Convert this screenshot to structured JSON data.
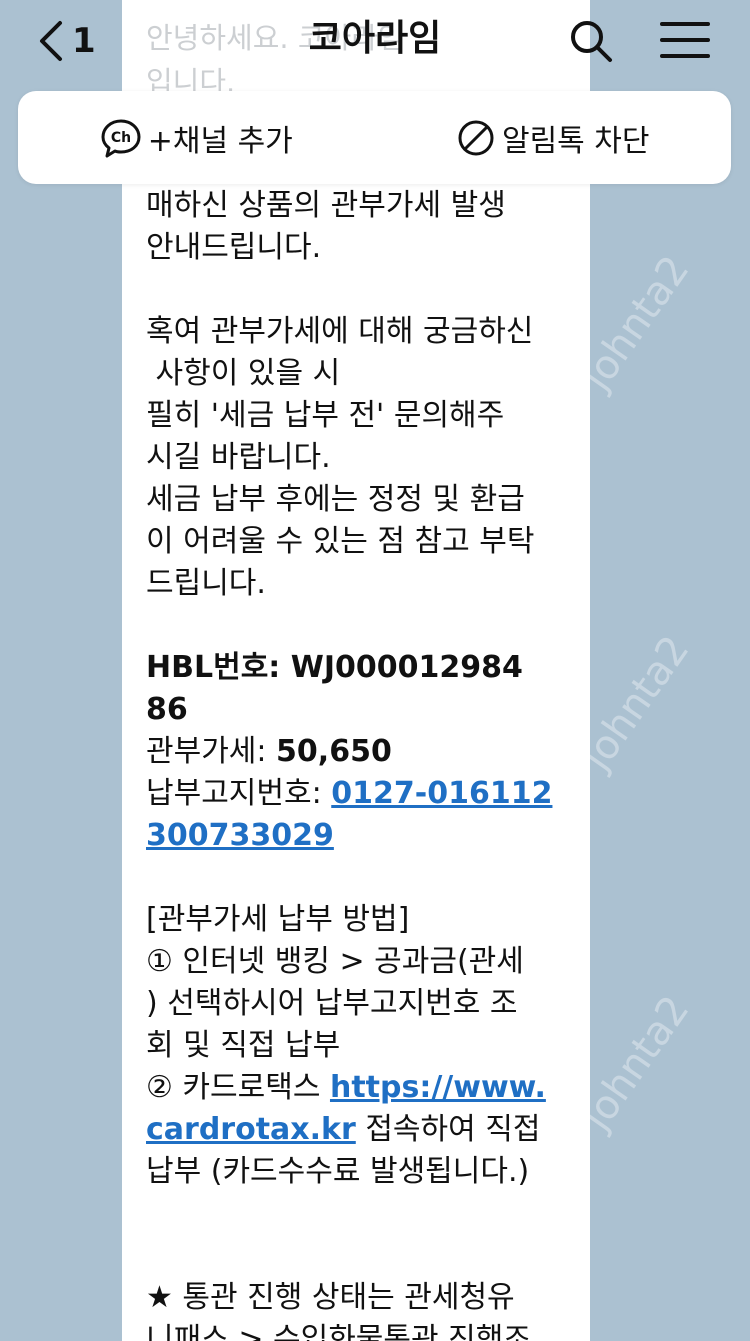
{
  "header": {
    "back_count": "1",
    "title": "코아라임"
  },
  "actions": {
    "add_channel": "+채널 추가",
    "block_alerts": "알림톡 차단"
  },
  "message": {
    "faded_top": "안녕하세요. 코아라임\n입니다.",
    "lines": [
      "매하신 상품의 관부가세 발생",
      "안내드립니다.",
      "",
      "혹여 관부가세에 대해 궁금하신",
      " 사항이 있을 시",
      "필히 '세금 납부 전' 문의해주",
      "시길 바랍니다.",
      "세금 납부 후에는 정정 및 환급",
      "이 어려울 수 있는 점 참고 부탁",
      "드립니다.",
      ""
    ],
    "hbl_label": "HBL번호: ",
    "hbl_value_1": "WJ000012984",
    "hbl_value_2": "86",
    "tax_label": "관부가세: ",
    "tax_value": "50,650",
    "notice_label": "납부고지번호: ",
    "notice_link_1": "0127-016112",
    "notice_link_2": "300733029",
    "method_title": "[관부가세 납부 방법]",
    "method_1a": "① 인터넷 뱅킹 > 공과금(관세",
    "method_1b": ") 선택하시어 납부고지번호 조",
    "method_1c": "회 및 직접 납부",
    "method_2_prefix": "② 카드로택스 ",
    "method_2_link_1": "https://www.",
    "method_2_link_2": "cardrotax.kr",
    "method_2_suffix": " 접속하여 직접",
    "method_2_line3": "납부 (카드수수료 발생됩니다.)",
    "status_line_1": "★ 통관 진행 상태는 관세청유",
    "status_line_2": "니패스 > 수입화물통관 진행조"
  },
  "watermark": "johnta2",
  "colors": {
    "background": "#abc1d1",
    "link": "#1f6fc4",
    "bubble": "#ffffff"
  }
}
